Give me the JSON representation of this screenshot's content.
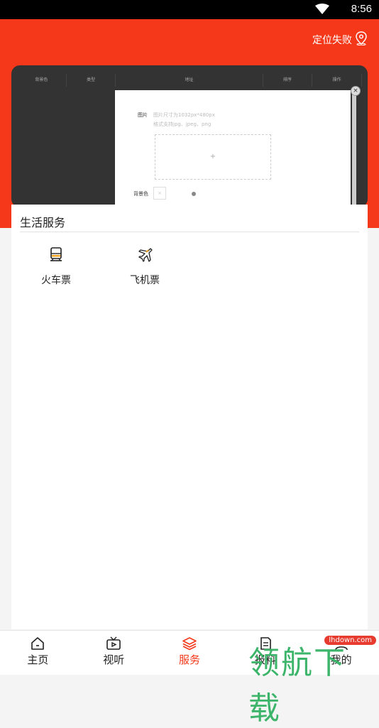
{
  "status_bar": {
    "time": "8:56"
  },
  "header": {
    "location_text": "定位失败"
  },
  "banner": {
    "table_headers": [
      "背景色",
      "类型",
      "地址",
      "排序",
      "操作"
    ],
    "image_label": "图片",
    "image_hint1": "图片尺寸为1032px*480px",
    "image_hint2": "格式支持jpg、jpeg、png",
    "upload_plus": "+",
    "bgcolor_label": "背景色",
    "swatch_mark": "×",
    "close_mark": "×"
  },
  "section": {
    "title": "生活服务",
    "items": [
      {
        "label": "火车票",
        "icon": "train-icon"
      },
      {
        "label": "飞机票",
        "icon": "airplane-icon"
      }
    ]
  },
  "tabs": [
    {
      "label": "主页",
      "icon": "home-icon"
    },
    {
      "label": "视听",
      "icon": "tv-icon"
    },
    {
      "label": "服务",
      "icon": "layers-icon",
      "active": true
    },
    {
      "label": "报料",
      "icon": "report-icon"
    },
    {
      "label": "我的",
      "icon": "user-icon"
    }
  ],
  "watermark": {
    "text": "领航下载",
    "domain": "lhdown.com"
  },
  "colors": {
    "accent": "#f5381a",
    "watermark": "#3cb46a"
  }
}
